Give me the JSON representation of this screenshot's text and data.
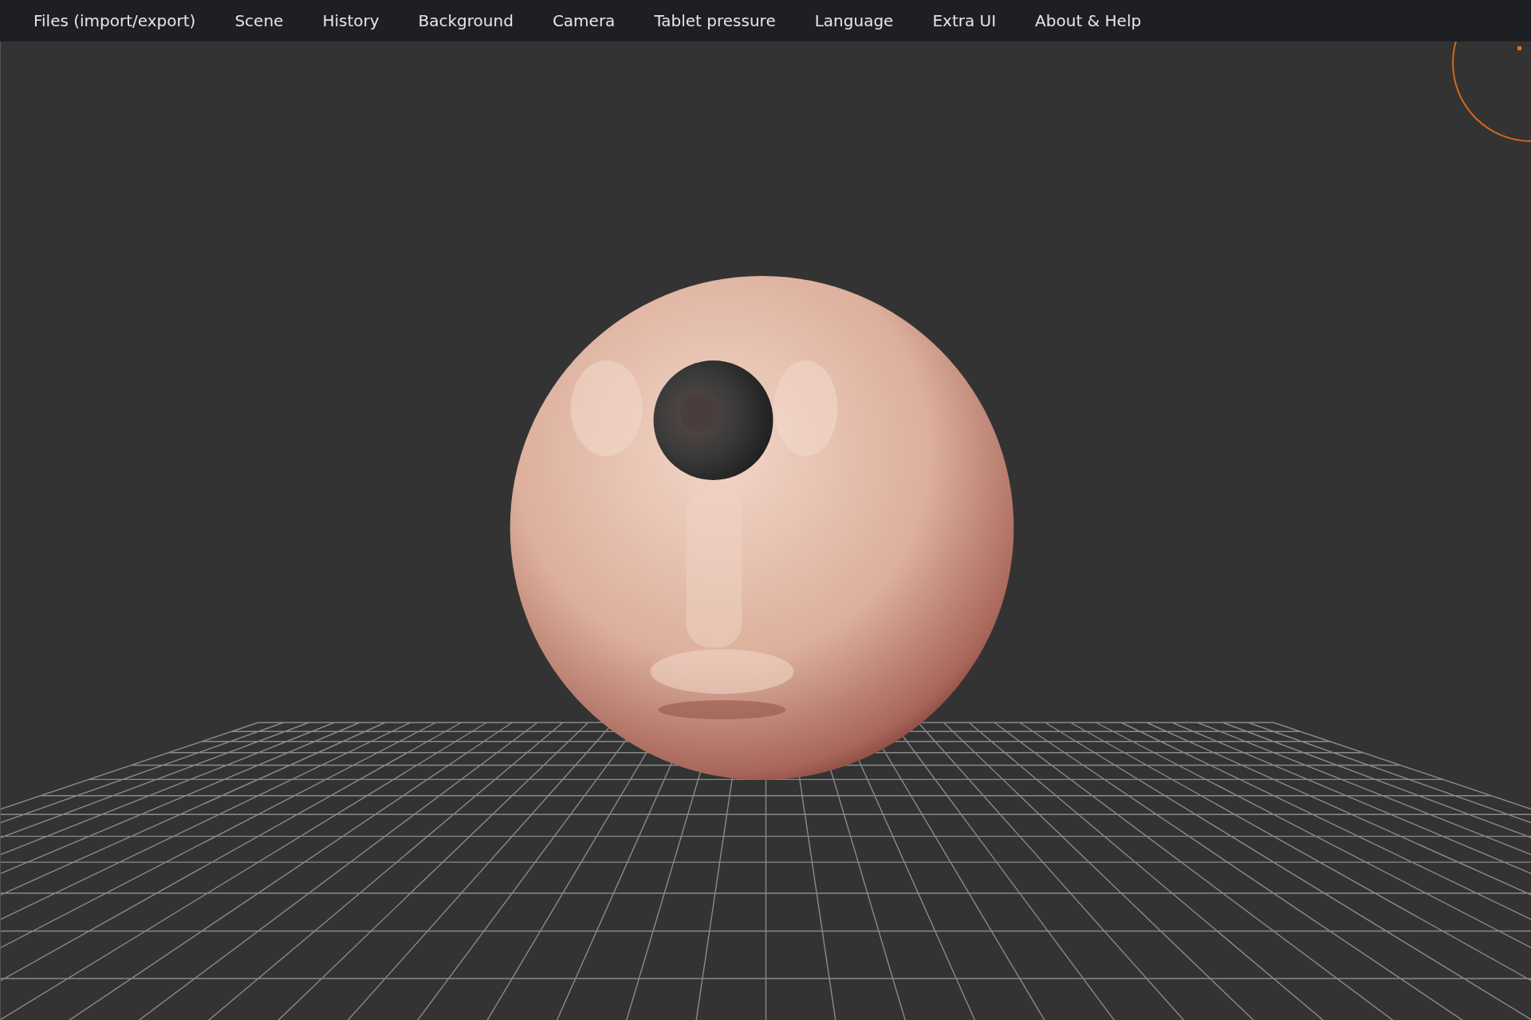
{
  "menu": [
    {
      "label": "Files (import/export)"
    },
    {
      "label": "Scene"
    },
    {
      "label": "History"
    },
    {
      "label": "Background"
    },
    {
      "label": "Camera"
    },
    {
      "label": "Tablet pressure"
    },
    {
      "label": "Language"
    },
    {
      "label": "Extra UI"
    },
    {
      "label": "About & Help"
    }
  ]
}
